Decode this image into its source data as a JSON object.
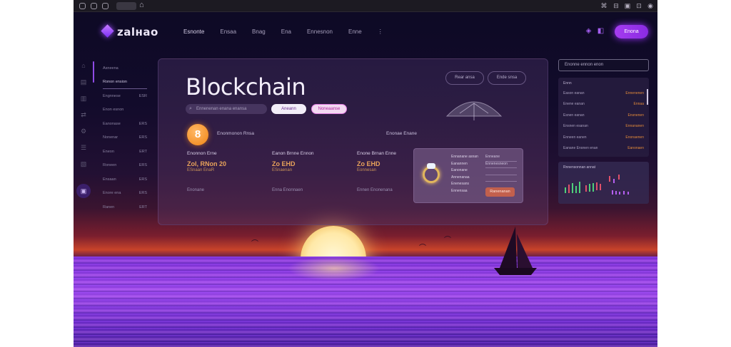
{
  "brand": {
    "name": "zalнaо"
  },
  "nav": {
    "items": [
      "Esnonte",
      "Ensaa",
      "Bnag",
      "Ena",
      "Ennesnon",
      "Enne",
      "⋮"
    ],
    "cta": "Enona"
  },
  "sidebar": {
    "items": [
      {
        "label": "Asneena",
        "value": ""
      },
      {
        "label": "Ronon ension",
        "value": ""
      },
      {
        "label": "Engnnese",
        "value": "ESR"
      },
      {
        "label": "Enon esnon",
        "value": ""
      },
      {
        "label": "Eanonase",
        "value": "ERS"
      },
      {
        "label": "Nonenar",
        "value": "ERS"
      },
      {
        "label": "Eneon",
        "value": "ERT"
      },
      {
        "label": "Roneen",
        "value": "ERS"
      },
      {
        "label": "Ensaan",
        "value": "ERS"
      },
      {
        "label": "Enore ena",
        "value": "ERS"
      },
      {
        "label": "Ranen",
        "value": "ERT"
      }
    ]
  },
  "main": {
    "headline": "Blockchain",
    "ghost_pills": [
      "Rear ansa",
      "Ende snsa"
    ],
    "search": "Ennenenan enana enansa",
    "pill_primary": "Aneann",
    "pill_secondary": "Noneaanse",
    "coin_symbol": "8",
    "coin_label": "Enonmonon Rnsa",
    "coin_right": "Enonae Enane",
    "stats": [
      {
        "label": "Enonnon Erne",
        "value": "Zol, RNon 20",
        "sub": "ESnaan EnaR",
        "foot": "Enonane"
      },
      {
        "label": "Eanon Brnne Ennon",
        "value": "Zo EНD",
        "sub": "ESnaenan",
        "foot": "Enna   Enonnaen"
      },
      {
        "label": "Enone Brnan Enne",
        "value": "Zo EНD",
        "sub": "Eonnesan",
        "foot": "Ennen   Enonenana"
      }
    ],
    "inner_panel": {
      "lines": [
        "Ennanane asnan",
        "Eanannen",
        "Eanonane",
        "Annenanaa",
        "Enenesans",
        "Ennensaa"
      ],
      "right_lines": [
        "Enneane",
        "Ennenesneon",
        "",
        ""
      ],
      "button": "Ranenanan"
    }
  },
  "right": {
    "search": "Enonne ennon enon",
    "panel_header": "Ennn",
    "rows": [
      {
        "label": "Eason  eanan",
        "value": "Ennenenen"
      },
      {
        "label": "Enene  eanan",
        "value": "Ennaa"
      },
      {
        "label": "Esnen  eanan",
        "value": "Ensnenen"
      },
      {
        "label": "Ensnen  esanan",
        "value": "Ennananen"
      },
      {
        "label": "Enneen  eanen",
        "value": "Enonaenen"
      },
      {
        "label": "Eanane  Enonen enan",
        "value": "Eanonaen"
      }
    ],
    "chart_title": "Rnnensonnan annat"
  },
  "colors": {
    "accent": "#9b30ff",
    "value": "#e8a35a",
    "button": "#c2604d"
  }
}
